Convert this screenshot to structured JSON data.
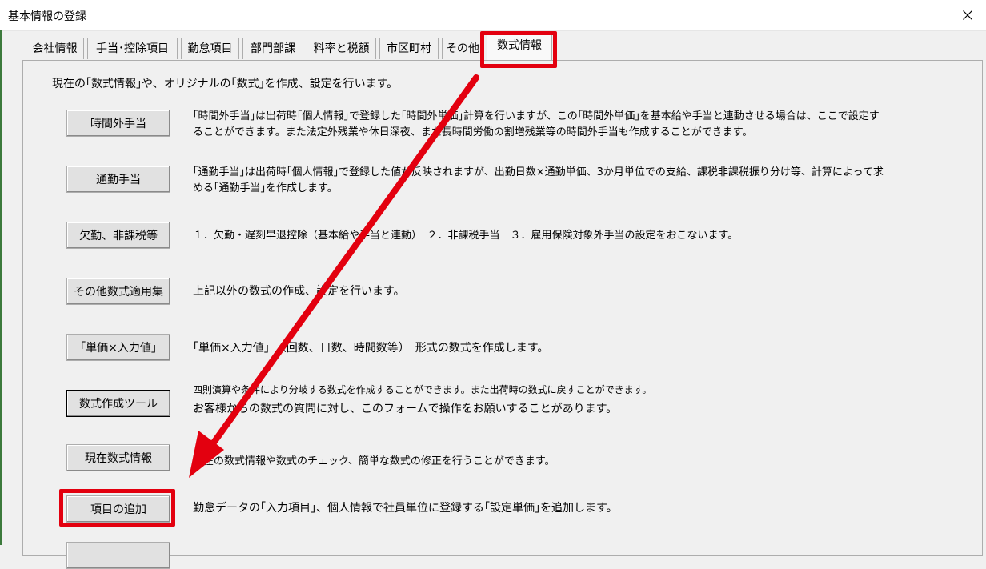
{
  "window": {
    "title": "基本情報の登録"
  },
  "tabs": [
    {
      "label": "会社情報"
    },
    {
      "label": "手当･控除項目"
    },
    {
      "label": "勤怠項目"
    },
    {
      "label": "部門部課"
    },
    {
      "label": "料率と税額"
    },
    {
      "label": "市区町村"
    },
    {
      "label": "その他"
    },
    {
      "label": "数式情報"
    }
  ],
  "panel": {
    "intro": "現在の｢数式情報｣や、オリジナルの｢数式｣を作成、設定を行います。",
    "items": [
      {
        "button": "時間外手当",
        "desc1": "｢時間外手当｣は出荷時｢個人情報｣で登録した｢時間外単価｣計算を行いますが、この｢時間外単価｣を基本給や手当と連動させる場合は、ここで設定す",
        "desc2": "ることができます。また法定外残業や休日深夜、また長時間労働の割増残業等の時間外手当も作成することができます。"
      },
      {
        "button": "通勤手当",
        "desc1": "｢通勤手当｣は出荷時｢個人情報｣で登録した値が反映されますが、出勤日数×通勤単価、3か月単位での支給、課税非課税振り分け等、計算によって求",
        "desc2": "める｢通勤手当｣を作成します。"
      },
      {
        "button": "欠勤、非課税等",
        "desc1": "１．欠勤・遅刻早退控除（基本給や手当と連動）　２．非課税手当　３．雇用保険対象外手当の設定をおこないます。"
      },
      {
        "button": "その他数式適用集",
        "desc1": "上記以外の数式の作成、設定を行います。"
      },
      {
        "button": "｢単価×入力値｣",
        "desc1": "｢単価×入力値｣　（回数、日数、時間数等）　形式の数式を作成します。"
      },
      {
        "button": "数式作成ツール",
        "desc1": "四則演算や条件により分岐する数式を作成することができます。また出荷時の数式に戻すことができます。",
        "desc2": "お客様からの数式の質問に対し、このフォームで操作をお願いすることがあります。"
      },
      {
        "button": "現在数式情報",
        "desc1": "現在の数式情報や数式のチェック、簡単な数式の修正を行うことができます。"
      },
      {
        "button": "項目の追加",
        "desc1": "勤怠データの｢入力項目｣、個人情報で社員単位に登録する｢設定単価｣を追加します。"
      }
    ]
  },
  "annotation": {
    "color": "#e3000f"
  }
}
